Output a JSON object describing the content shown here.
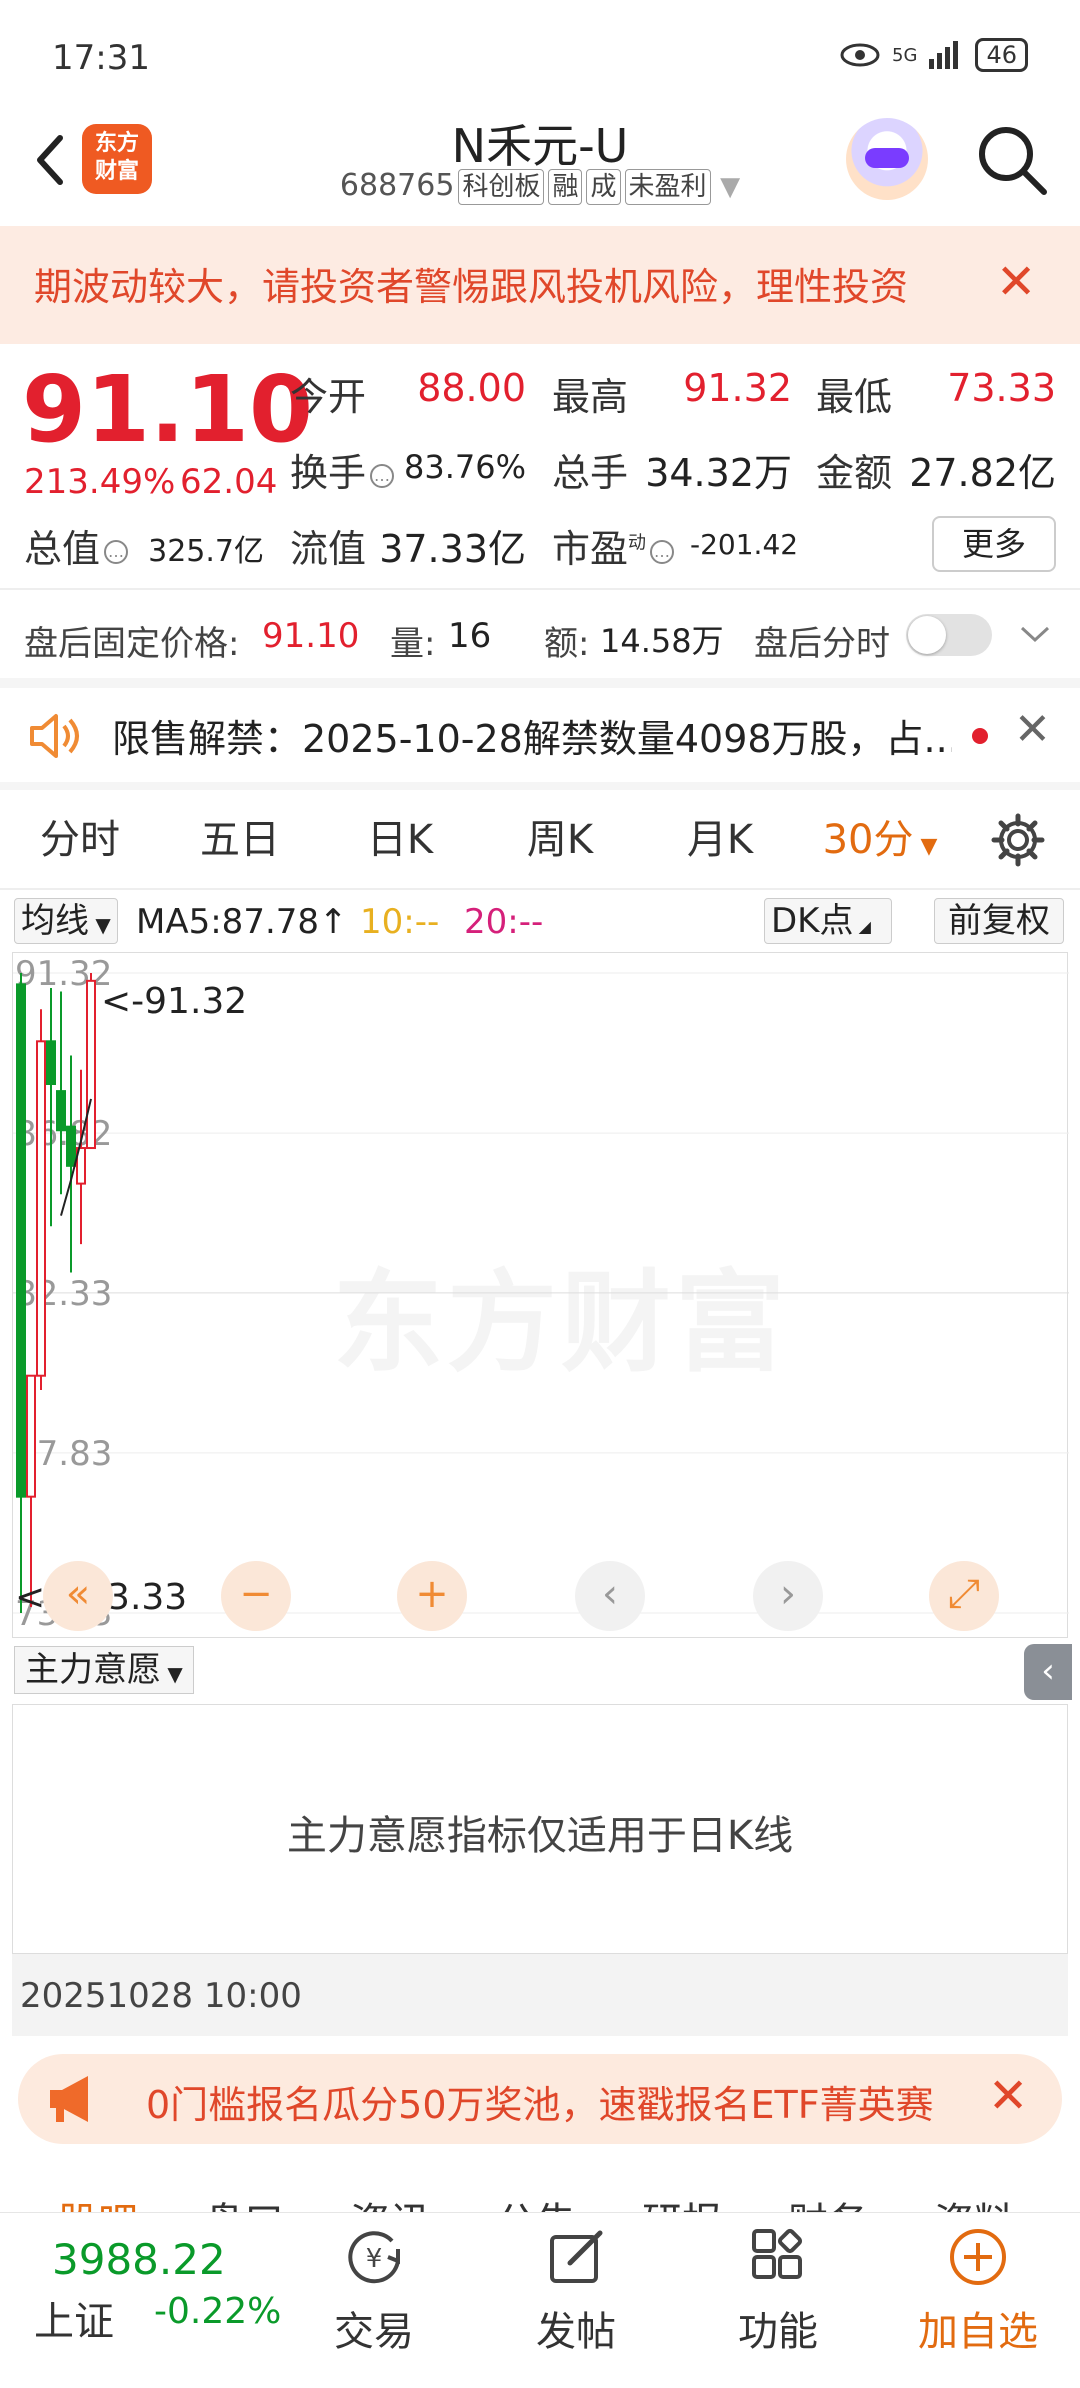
{
  "status": {
    "time": "17:31",
    "network": "5G",
    "battery": "46"
  },
  "header": {
    "logo_text_1": "东方",
    "logo_text_2": "财富",
    "name": "N禾元-U",
    "code": "688765",
    "tags": [
      "科创板",
      "融",
      "成",
      "未盈利"
    ]
  },
  "warning": {
    "text": "期波动较大，请投资者警惕跟风投机风险，理性投资"
  },
  "quote": {
    "price": "91.10",
    "change_pct": "213.49%",
    "change_amt": "62.04",
    "open_label": "今开",
    "open": "88.00",
    "high_label": "最高",
    "high": "91.32",
    "low_label": "最低",
    "low": "73.33",
    "turnover_label": "换手",
    "turnover": "83.76%",
    "volume_label": "总手",
    "volume": "34.32万",
    "amount_label": "金额",
    "amount": "27.82亿",
    "mktcap_label": "总值",
    "mktcap": "325.7亿",
    "float_label": "流值",
    "float": "37.33亿",
    "pe_label": "市盈",
    "pe_sup": "动",
    "pe": "-201.42",
    "more_label": "更多"
  },
  "after_hours": {
    "price_label": "盘后固定价格:",
    "price": "91.10",
    "vol_label": "量:",
    "vol": "16",
    "amt_label": "额:",
    "amt": "14.58万",
    "toggle_label": "盘后分时"
  },
  "notice": {
    "text": "限售解禁：2025-10-28解禁数量4098万股，占..."
  },
  "kline_tabs": [
    "分时",
    "五日",
    "日K",
    "周K",
    "月K",
    "30分"
  ],
  "ma": {
    "selector": "均线",
    "ma5": "MA5:87.78↑",
    "ma10": "10:--",
    "ma20": "20:--",
    "dk": "DK点",
    "adjust": "前复权"
  },
  "chart_data": {
    "type": "candlestick",
    "y_ticks": [
      "91.32",
      "86.82",
      "82.33",
      "77.83",
      "73.33"
    ],
    "ylim": [
      73.33,
      91.32
    ],
    "max_marker": "<-91.32",
    "min_marker": "<---73.33",
    "watermark": "东方财富",
    "candles": [
      {
        "open": 91.0,
        "high": 91.32,
        "low": 73.33,
        "close": 76.6
      },
      {
        "open": 76.6,
        "high": 80.0,
        "low": 73.5,
        "close": 80.0
      },
      {
        "open": 80.0,
        "high": 90.3,
        "low": 79.6,
        "close": 89.4
      },
      {
        "open": 89.4,
        "high": 90.9,
        "low": 84.2,
        "close": 88.2
      },
      {
        "open": 88.0,
        "high": 90.8,
        "low": 85.1,
        "close": 86.9
      },
      {
        "open": 87.0,
        "high": 89.0,
        "low": 82.9,
        "close": 85.9
      },
      {
        "open": 85.4,
        "high": 88.6,
        "low": 83.7,
        "close": 86.4
      },
      {
        "open": 86.4,
        "high": 91.32,
        "low": 86.4,
        "close": 91.1
      }
    ],
    "ma5_line": [
      null,
      null,
      null,
      null,
      84.5,
      85.5,
      86.6,
      87.78
    ]
  },
  "zoom_buttons": [
    "«",
    "−",
    "+",
    "‹",
    "›",
    "⤢"
  ],
  "main_force": {
    "selector": "主力意愿",
    "message": "主力意愿指标仅适用于日K线",
    "date": "20251028 10:00"
  },
  "promo": {
    "text": "0门槛报名瓜分50万奖池，速戳报名ETF菁英赛"
  },
  "peek_tabs": [
    "股吧",
    "盘口",
    "资讯",
    "公告",
    "研报",
    "财务",
    "资料"
  ],
  "bottom": {
    "index_value": "3988.22",
    "index_name": "上证",
    "index_change": "-0.22%",
    "nav": [
      "交易",
      "发帖",
      "功能",
      "加自选"
    ]
  }
}
